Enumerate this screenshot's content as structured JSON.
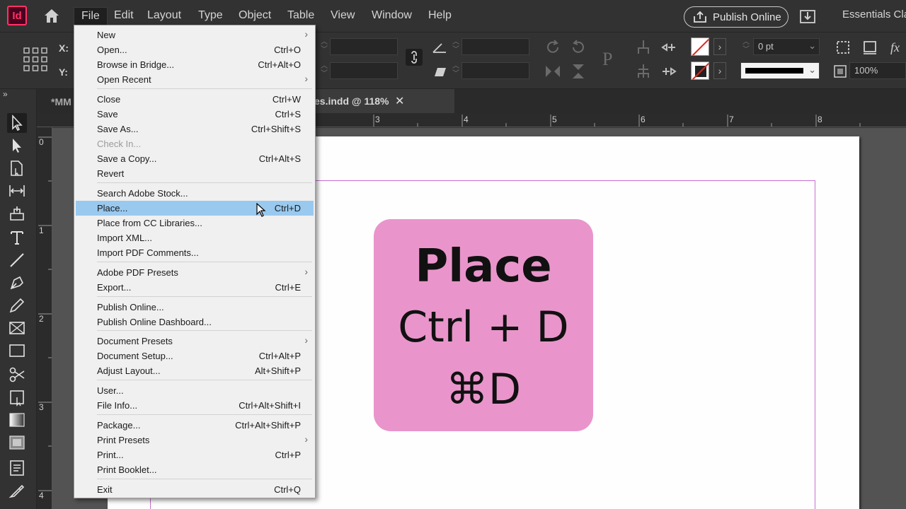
{
  "app": {
    "logo_text": "Id",
    "brand_color": "#ff3366"
  },
  "menubar": {
    "items": [
      "File",
      "Edit",
      "Layout",
      "Type",
      "Object",
      "Table",
      "View",
      "Window",
      "Help"
    ],
    "active": "File",
    "publish_label": "Publish Online",
    "workspace_label": "Essentials Cla"
  },
  "control": {
    "x_label": "X:",
    "y_label": "Y:",
    "stroke_weight": "0 pt",
    "zoom_percent": "100%"
  },
  "tabs": {
    "doc_a": "*MM",
    "doc_b": "es.indd @ 118%",
    "close_glyph": "✕"
  },
  "ruler": {
    "h_numbers": [
      "3",
      "4",
      "5",
      "6",
      "7",
      "8"
    ],
    "v_numbers": [
      "0",
      "1",
      "2",
      "3",
      "4"
    ]
  },
  "card": {
    "title": "Place",
    "windows_shortcut": "Ctrl + D",
    "mac_shortcut": "⌘D",
    "color": "#e995cb"
  },
  "file_menu": {
    "items": [
      {
        "label": "New",
        "shortcut": "",
        "submenu": true
      },
      {
        "label": "Open...",
        "shortcut": "Ctrl+O"
      },
      {
        "label": "Browse in Bridge...",
        "shortcut": "Ctrl+Alt+O"
      },
      {
        "label": "Open Recent",
        "shortcut": "",
        "submenu": true
      },
      {
        "label": "Close",
        "shortcut": "Ctrl+W"
      },
      {
        "label": "Save",
        "shortcut": "Ctrl+S"
      },
      {
        "label": "Save As...",
        "shortcut": "Ctrl+Shift+S"
      },
      {
        "label": "Check In...",
        "shortcut": "",
        "disabled": true
      },
      {
        "label": "Save a Copy...",
        "shortcut": "Ctrl+Alt+S"
      },
      {
        "label": "Revert",
        "shortcut": ""
      },
      {
        "label": "Search Adobe Stock...",
        "shortcut": ""
      },
      {
        "label": "Place...",
        "shortcut": "Ctrl+D",
        "highlighted": true
      },
      {
        "label": "Place from CC Libraries...",
        "shortcut": ""
      },
      {
        "label": "Import XML...",
        "shortcut": ""
      },
      {
        "label": "Import PDF Comments...",
        "shortcut": ""
      },
      {
        "label": "Adobe PDF Presets",
        "shortcut": "",
        "submenu": true
      },
      {
        "label": "Export...",
        "shortcut": "Ctrl+E"
      },
      {
        "label": "Publish Online...",
        "shortcut": ""
      },
      {
        "label": "Publish Online Dashboard...",
        "shortcut": ""
      },
      {
        "label": "Document Presets",
        "shortcut": "",
        "submenu": true
      },
      {
        "label": "Document Setup...",
        "shortcut": "Ctrl+Alt+P"
      },
      {
        "label": "Adjust Layout...",
        "shortcut": "Alt+Shift+P"
      },
      {
        "label": "User...",
        "shortcut": ""
      },
      {
        "label": "File Info...",
        "shortcut": "Ctrl+Alt+Shift+I"
      },
      {
        "label": "Package...",
        "shortcut": "Ctrl+Alt+Shift+P"
      },
      {
        "label": "Print Presets",
        "shortcut": "",
        "submenu": true
      },
      {
        "label": "Print...",
        "shortcut": "Ctrl+P"
      },
      {
        "label": "Print Booklet...",
        "shortcut": ""
      },
      {
        "label": "Exit",
        "shortcut": "Ctrl+Q"
      }
    ],
    "submenu_glyph": "›"
  }
}
